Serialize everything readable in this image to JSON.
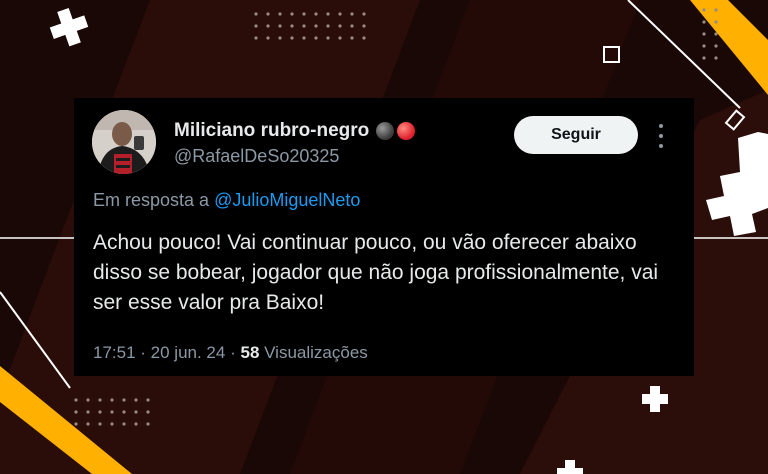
{
  "post": {
    "display_name": "Miliciano rubro-negro",
    "handle": "@RafaelDeSo20325",
    "follow_label": "Seguir",
    "reply_prefix": "Em resposta a",
    "reply_to": "@JulioMiguelNeto",
    "text": "Achou pouco! Vai continuar pouco, ou vão oferecer abaixo disso se bobear, jogador que não joga profissionalmente, vai ser esse valor pra Baixo!",
    "time": "17:51",
    "date": "20 jun. 24",
    "views_count": "58",
    "views_label": "Visualizações"
  },
  "icons": {
    "badges": [
      "black-circle-icon",
      "red-circle-icon"
    ],
    "more": "more-options-icon"
  },
  "colors": {
    "background": "#1a0806",
    "card": "#000000",
    "accent_yellow": "#ffb000",
    "link_blue": "#1d9bf0",
    "muted_text": "#8b98a5"
  }
}
